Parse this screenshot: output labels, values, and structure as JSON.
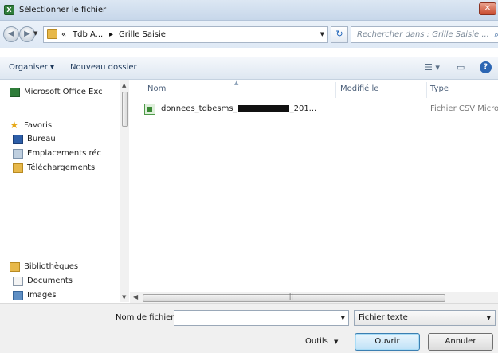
{
  "window": {
    "title": "Sélectionner le fichier",
    "close_glyph": "✕"
  },
  "address": {
    "back_glyph": "◀",
    "forward_glyph": "▶",
    "crumbs": [
      "«",
      "Tdb A...",
      "▸",
      "Grille Saisie"
    ],
    "refresh_glyph": "↻",
    "search_placeholder": "Rechercher dans : Grille Saisie ..."
  },
  "toolbar": {
    "organize": "Organiser ▾",
    "new_folder": "Nouveau dossier"
  },
  "nav": {
    "items": [
      {
        "label": "Microsoft Office Exc",
        "icon": "excel-icon"
      },
      {
        "label": "Favoris",
        "icon": "star-icon"
      },
      {
        "label": "Bureau",
        "icon": "desktop-icon"
      },
      {
        "label": "Emplacements réc",
        "icon": "recent-places-icon"
      },
      {
        "label": "Téléchargements",
        "icon": "downloads-icon"
      },
      {
        "label": "Bibliothèques",
        "icon": "libraries-icon"
      },
      {
        "label": "Documents",
        "icon": "documents-icon"
      },
      {
        "label": "Images",
        "icon": "images-icon"
      }
    ]
  },
  "filelist": {
    "columns": [
      "Nom",
      "Modifié le",
      "Type"
    ],
    "rows": [
      {
        "name_prefix": "donnees_tdbesms_",
        "name_suffix": "_201...",
        "modified": "",
        "type": "Fichier CSV Micro"
      }
    ]
  },
  "bottom": {
    "filename_label": "Nom de fichier :",
    "filename_value": "",
    "filter_value": "Fichier texte",
    "tools_label": "Outils",
    "open_label": "Ouvrir",
    "cancel_label": "Annuler"
  },
  "colors": {
    "accent": "#2c66b3",
    "titlebar": "#c7d7ea",
    "folder": "#e7b84a"
  }
}
